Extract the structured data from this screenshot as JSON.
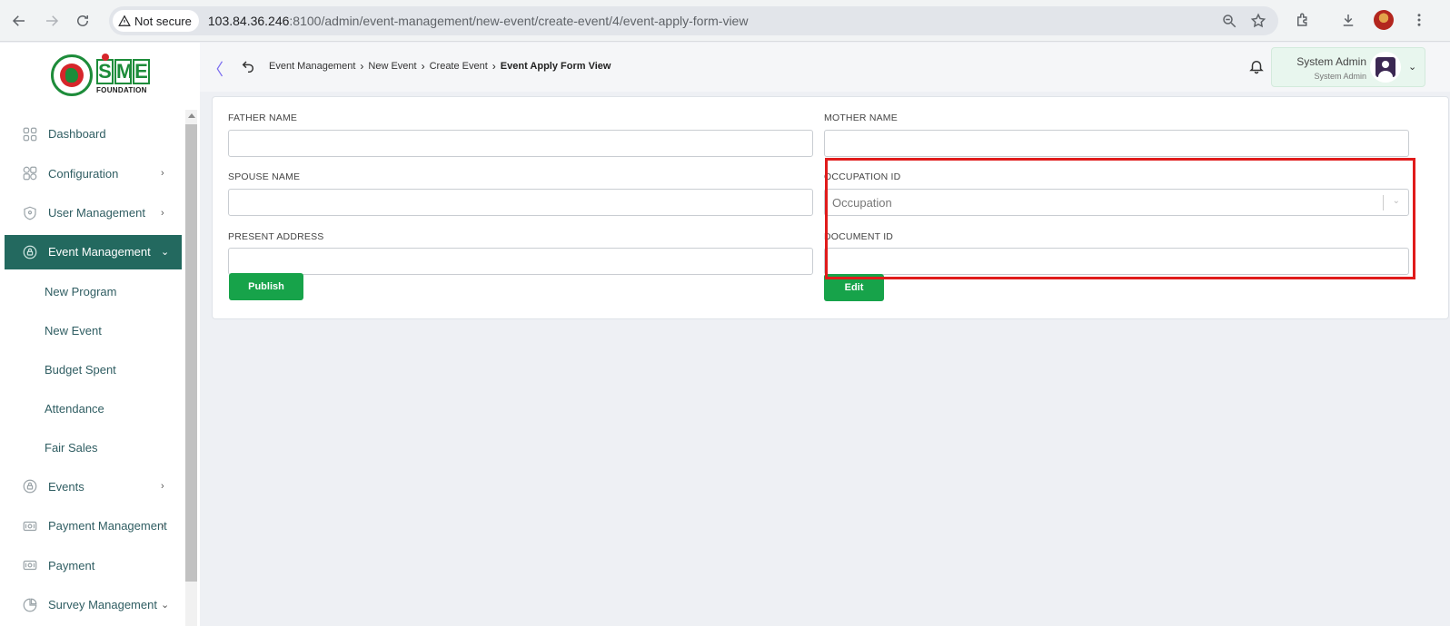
{
  "browser": {
    "security_label": "Not secure",
    "url_host": "103.84.36.246",
    "url_path": ":8100/admin/event-management/new-event/create-event/4/event-apply-form-view"
  },
  "logo": {
    "letters": [
      "S",
      "M",
      "E"
    ],
    "subtitle": "FOUNDATION"
  },
  "breadcrumb": {
    "items": [
      "Event Management",
      "New Event",
      "Create Event"
    ],
    "current": "Event Apply Form View",
    "separator": "›"
  },
  "user": {
    "name": "System Admin",
    "role": "System Admin"
  },
  "sidebar": {
    "items": [
      {
        "label": "Dashboard",
        "icon": "dashboard-grid-icon",
        "has_arrow": false,
        "arrow": ""
      },
      {
        "label": "Configuration",
        "icon": "configuration-icon",
        "has_arrow": true,
        "arrow": "›"
      },
      {
        "label": "User Management",
        "icon": "shield-icon",
        "has_arrow": true,
        "arrow": "›"
      },
      {
        "label": "Event Management",
        "icon": "lock-circle-icon",
        "has_arrow": true,
        "arrow": "⌄",
        "active": true
      }
    ],
    "sub_items": [
      "New Program",
      "New Event",
      "Budget Spent",
      "Attendance",
      "Fair Sales"
    ],
    "items_after": [
      {
        "label": "Events",
        "icon": "lock-circle-icon",
        "arrow": "›"
      },
      {
        "label": "Payment Management",
        "icon": "payment-icon",
        "arrow": "›"
      },
      {
        "label": "Payment",
        "icon": "payment-icon",
        "arrow": ""
      },
      {
        "label": "Survey Management",
        "icon": "pie-chart-icon",
        "arrow": "⌄"
      }
    ]
  },
  "form": {
    "father_name_label": "FATHER NAME",
    "mother_name_label": "MOTHER NAME",
    "spouse_name_label": "SPOUSE NAME",
    "occupation_id_label": "OCCUPATION ID",
    "occupation_placeholder": "Occupation",
    "present_address_label": "PRESENT ADDRESS",
    "document_id_label": "DOCUMENT ID",
    "father_name_value": "",
    "mother_name_value": "",
    "spouse_name_value": "",
    "present_address_value": "",
    "document_id_value": "",
    "publish_label": "Publish",
    "edit_label": "Edit"
  },
  "colors": {
    "sidebar_active": "#23695f",
    "button_green": "#17a34a",
    "highlight_red": "#e01b1b",
    "brand_green": "#1d8c3a",
    "brand_red": "#d6262b"
  }
}
